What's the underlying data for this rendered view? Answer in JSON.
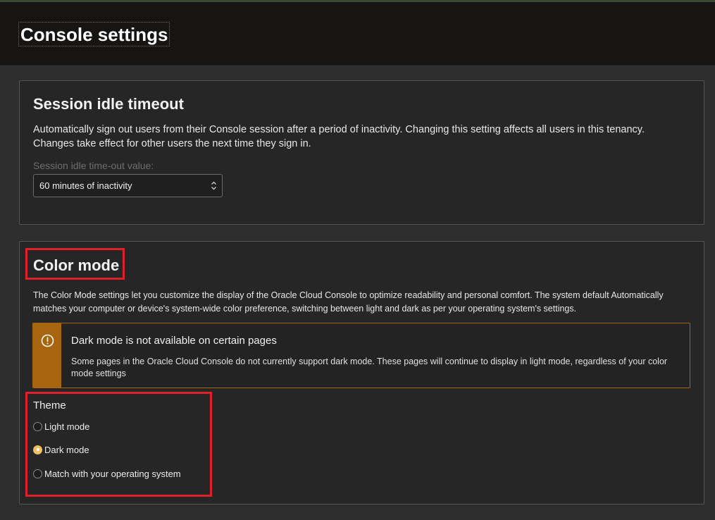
{
  "header": {
    "title": "Console settings"
  },
  "session": {
    "title": "Session idle timeout",
    "description": "Automatically sign out users from their Console session after a period of inactivity. Changing this setting affects all users in this tenancy. Changes take effect for other users the next time they sign in.",
    "field_label": "Session idle time-out value:",
    "selected_value": "60 minutes of inactivity"
  },
  "color_mode": {
    "title": "Color mode",
    "description": "The Color Mode settings let you customize the display of the Oracle Cloud Console to optimize readability and personal comfort. The system default Automatically matches your computer or device's system-wide color preference, switching between light and dark as per your operating system's settings.",
    "alert": {
      "title": "Dark mode is not available on certain pages",
      "body": "Some pages in the Oracle Cloud Console do not currently support dark mode. These pages will continue to display in light mode, regardless of your color mode settings"
    },
    "theme": {
      "label": "Theme",
      "options": [
        {
          "label": "Light mode",
          "checked": false
        },
        {
          "label": "Dark mode",
          "checked": true
        },
        {
          "label": "Match with your operating system",
          "checked": false
        }
      ]
    }
  },
  "colors": {
    "header_bg": "#161513",
    "page_bg": "#2d2d2d",
    "warning": "#a8650f",
    "highlight": "#e0202a",
    "radio_selected": "#f0c060"
  }
}
